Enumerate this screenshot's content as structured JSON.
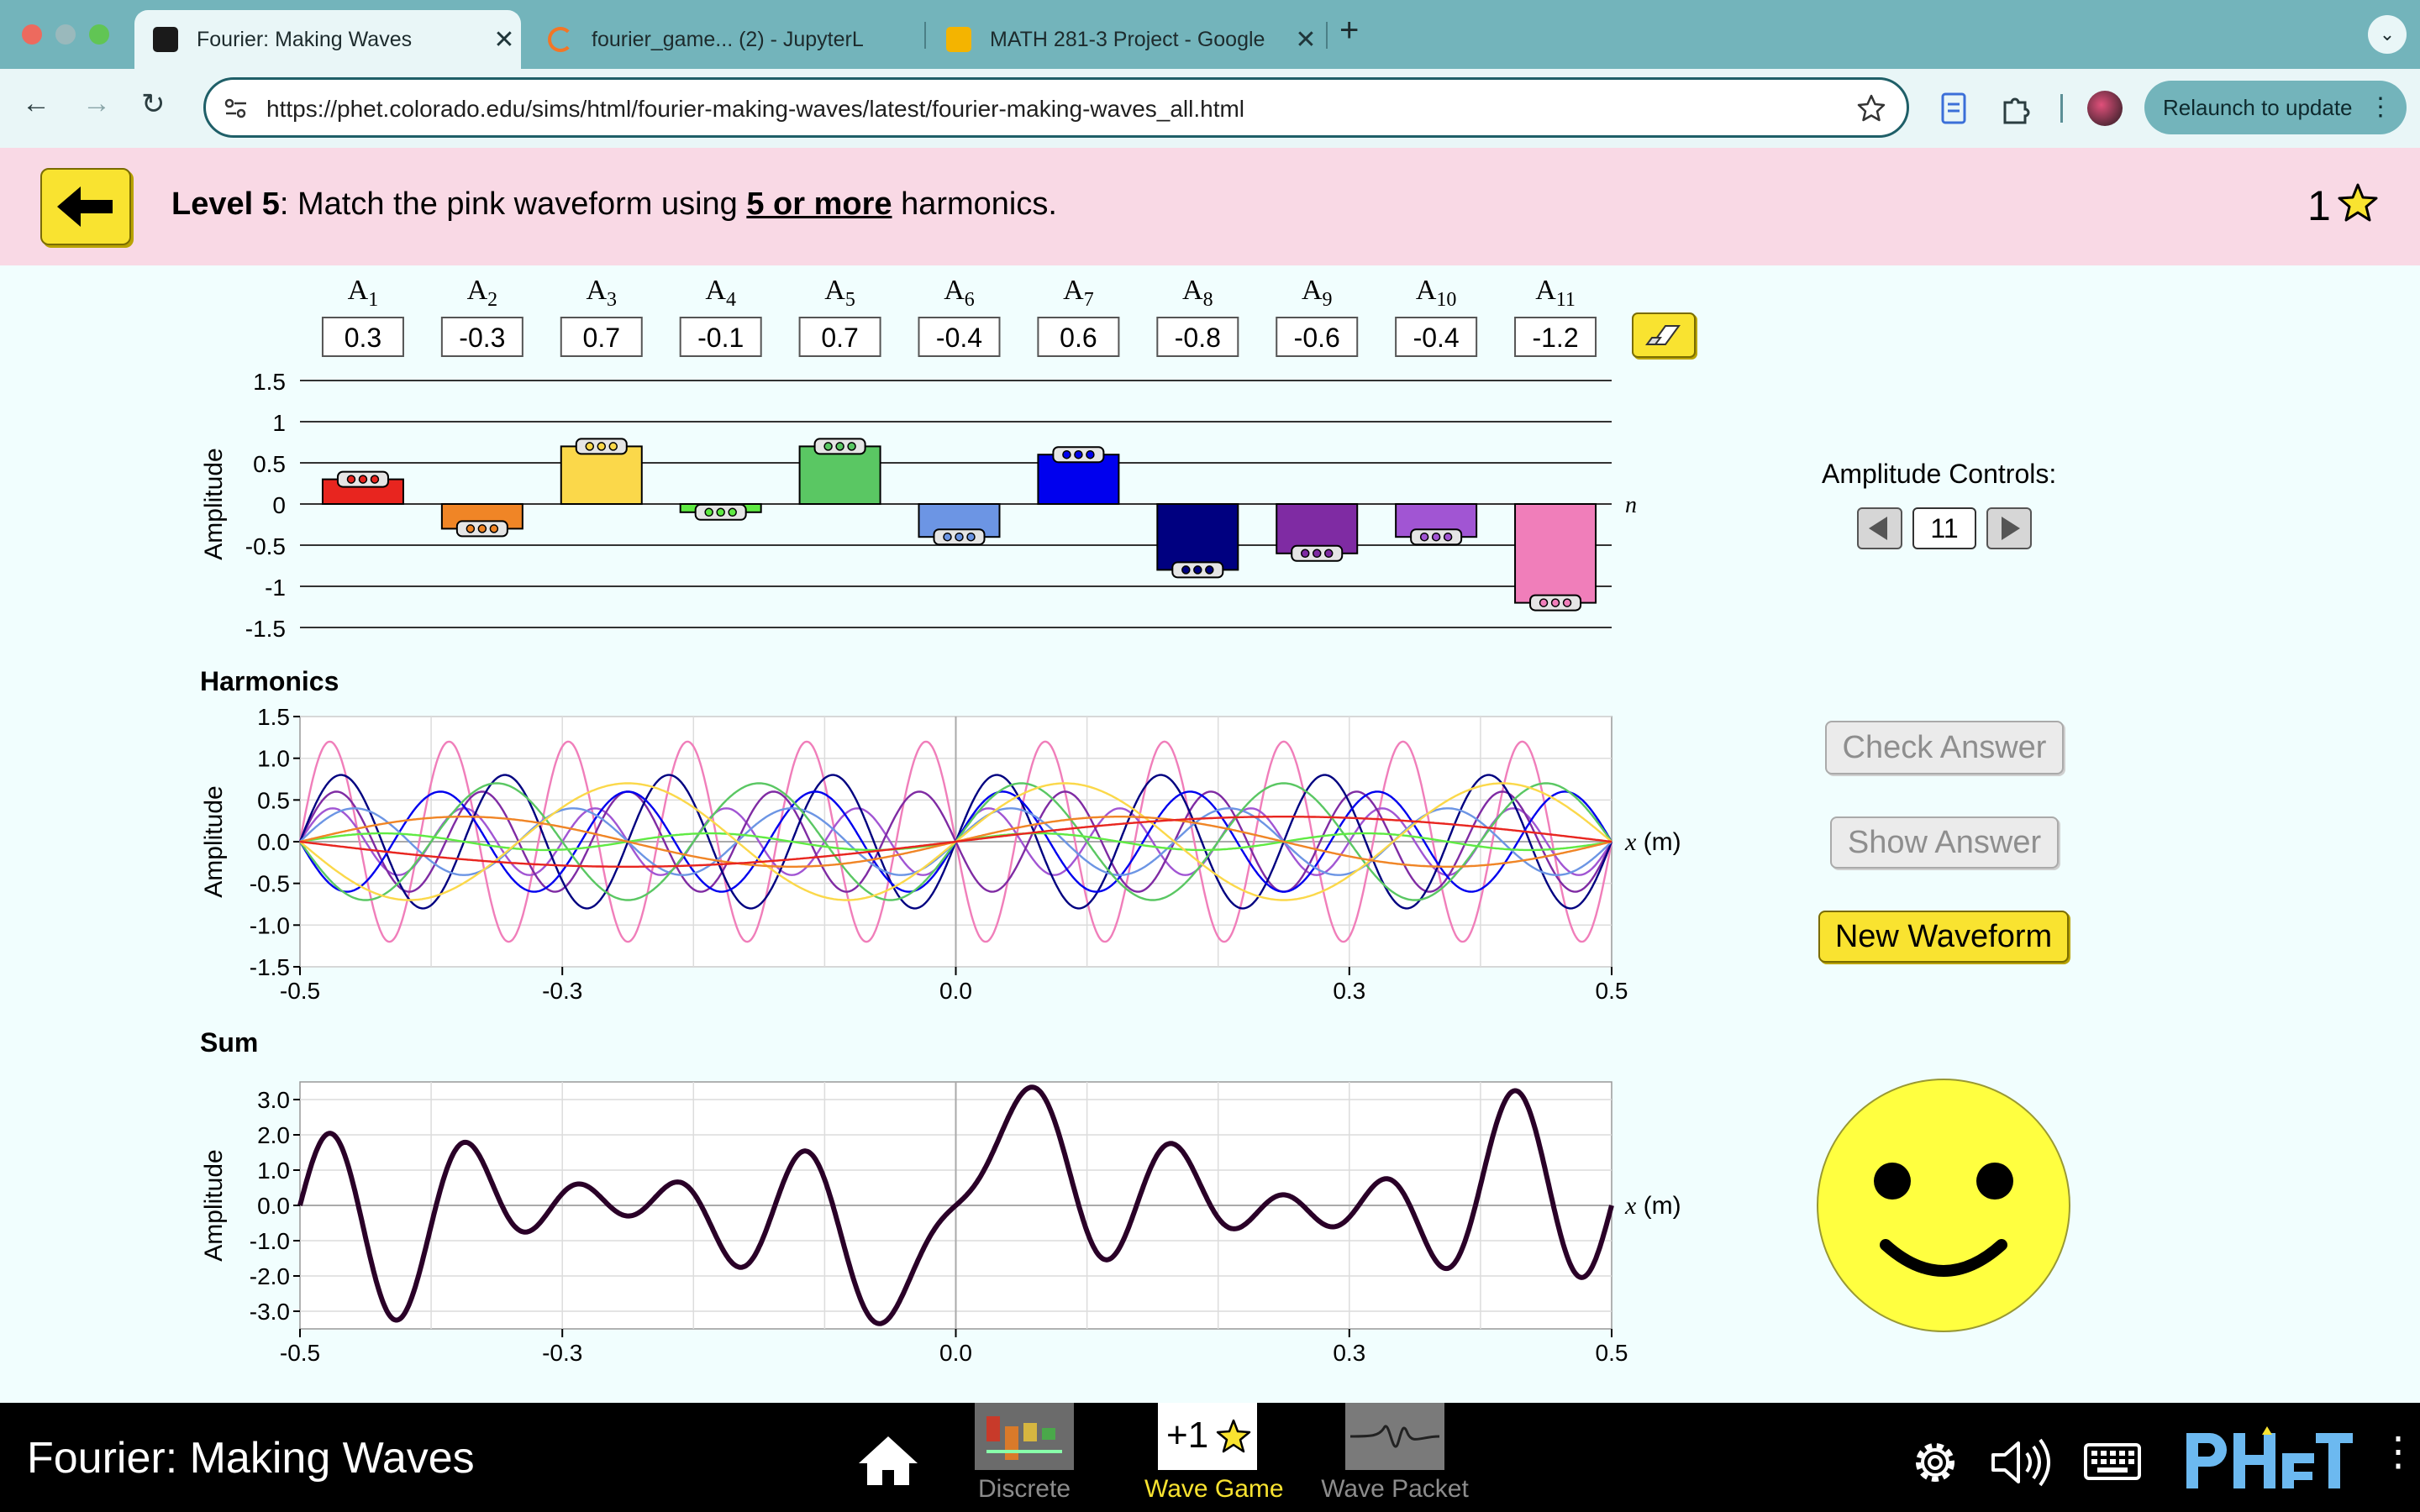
{
  "browser": {
    "tabs": [
      {
        "title": "Fourier: Making Waves",
        "active": true,
        "icon": "phet-icon"
      },
      {
        "title": "fourier_game... (2) - JupyterL",
        "active": false,
        "icon": "jupyter-icon"
      },
      {
        "title": "MATH 281-3 Project - Google",
        "active": false,
        "icon": "slides-icon"
      }
    ],
    "close_glyph": "✕",
    "new_tab_glyph": "+",
    "url": "https://phet.colorado.edu/sims/html/fourier-making-waves/latest/fourier-making-waves_all.html",
    "relaunch_label": "Relaunch to update"
  },
  "level": {
    "label": "Level 5",
    "text_a": ": Match the pink waveform using ",
    "emphasis": "5 or more",
    "text_b": " harmonics.",
    "score": "1"
  },
  "amplitudes": {
    "labels": [
      {
        "base": "A",
        "sub": "1"
      },
      {
        "base": "A",
        "sub": "2"
      },
      {
        "base": "A",
        "sub": "3"
      },
      {
        "base": "A",
        "sub": "4"
      },
      {
        "base": "A",
        "sub": "5"
      },
      {
        "base": "A",
        "sub": "6"
      },
      {
        "base": "A",
        "sub": "7"
      },
      {
        "base": "A",
        "sub": "8"
      },
      {
        "base": "A",
        "sub": "9"
      },
      {
        "base": "A",
        "sub": "10"
      },
      {
        "base": "A",
        "sub": "11"
      }
    ],
    "values": [
      0.3,
      -0.3,
      0.7,
      -0.1,
      0.7,
      -0.4,
      0.6,
      -0.8,
      -0.6,
      -0.4,
      -1.2
    ],
    "display": [
      "0.3",
      "-0.3",
      "0.7",
      "-0.1",
      "0.7",
      "-0.4",
      "0.6",
      "-0.8",
      "-0.6",
      "-0.4",
      "-1.2"
    ],
    "colors": [
      "#e8251f",
      "#f08526",
      "#fbd84a",
      "#5fea43",
      "#5ac763",
      "#6c95e4",
      "#0000ee",
      "#000080",
      "#7f2ba3",
      "#a155d3",
      "#f07eba"
    ],
    "y_ticks": [
      "1.5",
      "1",
      "0.5",
      "0",
      "-0.5",
      "-1",
      "-1.5"
    ],
    "y_label": "Amplitude",
    "n_label": "n"
  },
  "controls": {
    "amplitude_controls_label": "Amplitude Controls:",
    "harmonic_count": "11",
    "check_answer": "Check Answer",
    "show_answer": "Show Answer",
    "new_waveform": "New Waveform"
  },
  "chart_data": [
    {
      "type": "line",
      "title": "Harmonics",
      "xlabel": "x (m)",
      "ylabel": "Amplitude",
      "xlim": [
        -0.5,
        0.5
      ],
      "ylim": [
        -1.5,
        1.5
      ],
      "x_ticks": [
        "-0.5",
        "-0.3",
        "0.0",
        "0.3",
        "0.5"
      ],
      "y_ticks": [
        "1.5",
        "1.0",
        "0.5",
        "0.0",
        "-0.5",
        "-1.0",
        "-1.5"
      ],
      "series_formula": "y_n = A_n * sin(2*pi*n*x), n = 1..11"
    },
    {
      "type": "line",
      "title": "Sum",
      "xlabel": "x (m)",
      "ylabel": "Amplitude",
      "xlim": [
        -0.5,
        0.5
      ],
      "ylim": [
        -3.5,
        3.5
      ],
      "x_ticks": [
        "-0.5",
        "-0.3",
        "0.0",
        "0.3",
        "0.5"
      ],
      "y_ticks": [
        "3.0",
        "2.0",
        "1.0",
        "0.0",
        "-1.0",
        "-2.0",
        "-3.0"
      ],
      "series_formula": "sum of A_n * sin(2*pi*n*x), n = 1..11",
      "color": "#2a0028"
    }
  ],
  "navbar": {
    "sim_title": "Fourier: Making Waves",
    "screens": [
      {
        "label": "Discrete",
        "selected": false
      },
      {
        "label": "Wave Game",
        "selected": true,
        "thumb_text": "+1"
      },
      {
        "label": "Wave Packet",
        "selected": false
      }
    ]
  }
}
